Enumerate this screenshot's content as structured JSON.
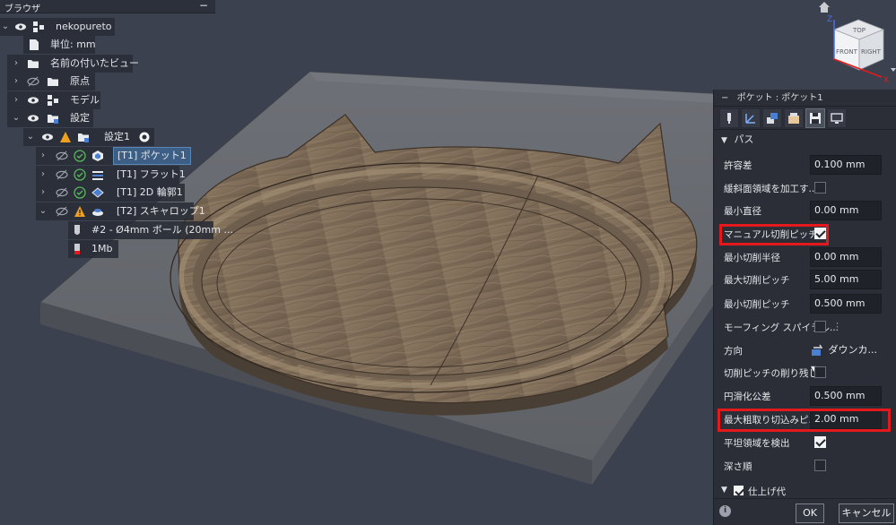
{
  "browser": {
    "title": "ブラウザ",
    "minimize": "−",
    "items": [
      {
        "label": "nekopureto"
      },
      {
        "label": "単位: mm"
      },
      {
        "label": "名前の付いたビュー"
      },
      {
        "label": "原点"
      },
      {
        "label": "モデル"
      },
      {
        "label": "設定"
      },
      {
        "label": "設定1"
      },
      {
        "label": "[T1] ポケット1"
      },
      {
        "label": "[T1] フラット1"
      },
      {
        "label": "[T1] 2D 輪郭1"
      },
      {
        "label": "[T2] スキャロップ1"
      },
      {
        "label": "#2 - Ø4mm ボール (20mm ..."
      },
      {
        "label": "1Mb"
      }
    ]
  },
  "viewcube": {
    "top": "TOP",
    "front": "FRONT",
    "right": "RIGHT",
    "axis_z": "Z",
    "axis_x": "X"
  },
  "panel": {
    "header": "ポケット : ポケット1",
    "header_collapse": "−",
    "section": "パス",
    "rows": [
      {
        "label": "許容差",
        "value": "0.100 mm"
      },
      {
        "label": "緩斜面領域を加工す..."
      },
      {
        "label": "最小直径",
        "value": "0.00 mm"
      },
      {
        "label": "マニュアル切削ピッチ"
      },
      {
        "label": "最小切削半径",
        "value": "0.00 mm"
      },
      {
        "label": "最大切削ピッチ",
        "value": "5.00 mm"
      },
      {
        "label": "最小切削ピッチ",
        "value": "0.500 mm"
      },
      {
        "label": "モーフィング スパイラル..."
      },
      {
        "label": "方向",
        "value": "ダウンカ..."
      },
      {
        "label": "切削ピッチの削り残し..."
      },
      {
        "label": "円滑化公差",
        "value": "0.500 mm"
      },
      {
        "label": "最大粗取り切込みピ...",
        "value": "2.00 mm"
      },
      {
        "label": "平坦領域を検出"
      },
      {
        "label": "深さ順"
      }
    ],
    "next_section": "仕上げ代",
    "ok": "OK",
    "cancel": "キャンセル"
  },
  "colors": {
    "background": "#3c4150",
    "highlight": "#e5191c",
    "selection": "#3d5f86"
  }
}
